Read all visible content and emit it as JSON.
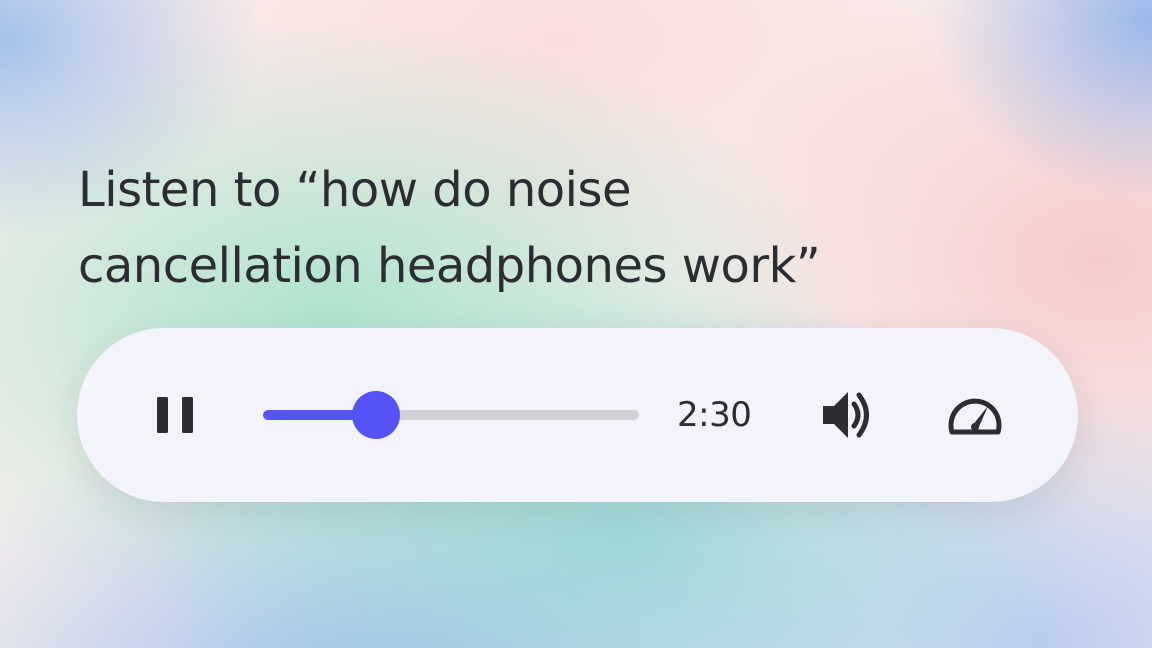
{
  "heading": {
    "line1": "Listen to “how do noise",
    "line2": "cancellation headphones work”"
  },
  "player": {
    "pause_icon": "pause-icon",
    "elapsed_time": "2:30",
    "progress_fraction": 0.3,
    "volume_icon": "volume-up-icon",
    "speed_icon": "speedometer-icon"
  },
  "colors": {
    "accent": "#5753f7",
    "track": "#cfd0d6",
    "text": "#2b2d33",
    "player_background": "#f3f4fb"
  }
}
